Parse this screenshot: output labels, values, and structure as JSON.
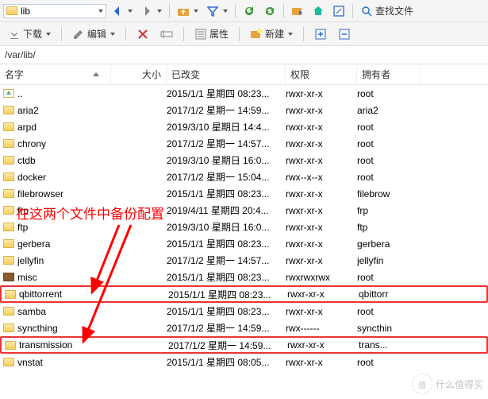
{
  "toolbar": {
    "path_combo": "lib",
    "download": "下载",
    "edit": "编辑",
    "props": "属性",
    "new": "新建",
    "find": "查找文件"
  },
  "pathbar": "/var/lib/",
  "columns": {
    "name": "名字",
    "size": "大小",
    "changed": "已改变",
    "perm": "权限",
    "owner": "拥有者"
  },
  "annotation": "在这两个文件中备份配置",
  "watermark": "什么值得买",
  "watermark_badge": "值",
  "rows": [
    {
      "icon": "up",
      "name": "..",
      "changed": "2015/1/1 星期四 08:23...",
      "perm": "rwxr-xr-x",
      "owner": "root"
    },
    {
      "icon": "folder",
      "name": "aria2",
      "changed": "2017/1/2 星期一 14:59...",
      "perm": "rwxr-xr-x",
      "owner": "aria2"
    },
    {
      "icon": "folder",
      "name": "arpd",
      "changed": "2019/3/10 星期日 14:4...",
      "perm": "rwxr-xr-x",
      "owner": "root"
    },
    {
      "icon": "folder",
      "name": "chrony",
      "changed": "2017/1/2 星期一 14:57...",
      "perm": "rwxr-xr-x",
      "owner": "root"
    },
    {
      "icon": "folder",
      "name": "ctdb",
      "changed": "2019/3/10 星期日 16:0...",
      "perm": "rwxr-xr-x",
      "owner": "root"
    },
    {
      "icon": "folder",
      "name": "docker",
      "changed": "2017/1/2 星期一 15:04...",
      "perm": "rwx--x--x",
      "owner": "root"
    },
    {
      "icon": "folder",
      "name": "filebrowser",
      "changed": "2015/1/1 星期四 08:23...",
      "perm": "rwxr-xr-x",
      "owner": "filebrow"
    },
    {
      "icon": "folder",
      "name": "frp",
      "changed": "2019/4/11 星期四 20:4...",
      "perm": "rwxr-xr-x",
      "owner": "frp"
    },
    {
      "icon": "folder",
      "name": "ftp",
      "changed": "2019/3/10 星期日 16:0...",
      "perm": "rwxr-xr-x",
      "owner": "ftp"
    },
    {
      "icon": "folder",
      "name": "gerbera",
      "changed": "2015/1/1 星期四 08:23...",
      "perm": "rwxr-xr-x",
      "owner": "gerbera"
    },
    {
      "icon": "folder",
      "name": "jellyfin",
      "changed": "2017/1/2 星期一 14:57...",
      "perm": "rwxr-xr-x",
      "owner": "jellyfin"
    },
    {
      "icon": "briefcase",
      "name": "misc",
      "changed": "2015/1/1 星期四 08:23...",
      "perm": "rwxrwxrwx",
      "owner": "root"
    },
    {
      "icon": "folder",
      "name": "qbittorrent",
      "changed": "2015/1/1 星期四 08:23...",
      "perm": "rwxr-xr-x",
      "owner": "qbittorr",
      "hl": true
    },
    {
      "icon": "folder",
      "name": "samba",
      "changed": "2015/1/1 星期四 08:23...",
      "perm": "rwxr-xr-x",
      "owner": "root"
    },
    {
      "icon": "folder",
      "name": "syncthing",
      "changed": "2017/1/2 星期一 14:59...",
      "perm": "rwx------",
      "owner": "syncthin"
    },
    {
      "icon": "folder",
      "name": "transmission",
      "changed": "2017/1/2 星期一 14:59...",
      "perm": "rwxr-xr-x",
      "owner": "trans...",
      "hl": true
    },
    {
      "icon": "folder",
      "name": "vnstat",
      "changed": "2015/1/1 星期四 08:05...",
      "perm": "rwxr-xr-x",
      "owner": "root"
    }
  ]
}
